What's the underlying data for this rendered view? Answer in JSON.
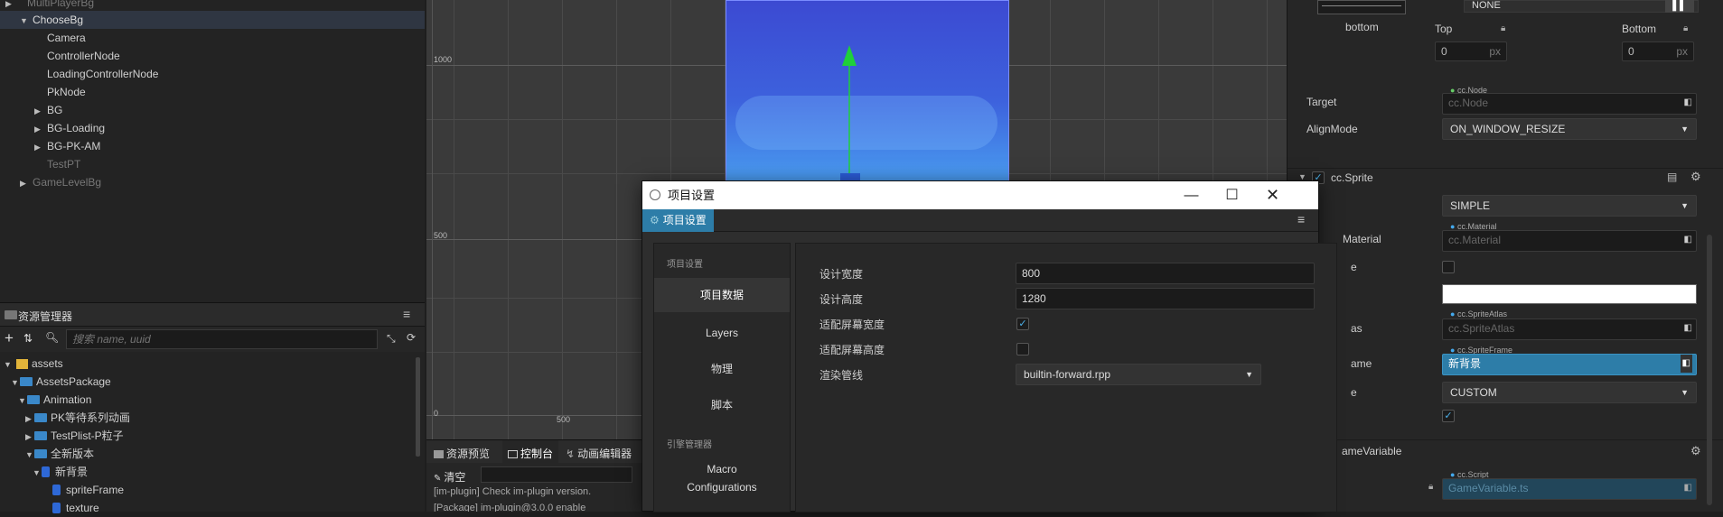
{
  "hierarchy": {
    "items": [
      {
        "label": "MultiPlayerBg",
        "dim": true
      },
      {
        "label": "ChooseBg"
      },
      {
        "label": "Camera"
      },
      {
        "label": "ControllerNode"
      },
      {
        "label": "LoadingControllerNode"
      },
      {
        "label": "PkNode"
      },
      {
        "label": "BG"
      },
      {
        "label": "BG-Loading"
      },
      {
        "label": "BG-PK-AM"
      },
      {
        "label": "TestPT",
        "dim": true
      },
      {
        "label": "GameLevelBg",
        "dim": true
      }
    ]
  },
  "assets": {
    "title": "资源管理器",
    "search_placeholder": "搜索 name, uuid",
    "items": [
      {
        "label": "assets"
      },
      {
        "label": "AssetsPackage"
      },
      {
        "label": "Animation"
      },
      {
        "label": "PK等待系列动画"
      },
      {
        "label": "TestPlist-P粒子"
      },
      {
        "label": "全新版本"
      },
      {
        "label": "新背景"
      },
      {
        "label": "spriteFrame"
      },
      {
        "label": "texture"
      }
    ]
  },
  "scene": {
    "ruler": [
      "1000",
      "500",
      "0",
      "500"
    ]
  },
  "bottom_panel": {
    "tabs": [
      "资源预览",
      "控制台",
      "动画编辑器"
    ],
    "clear_label": "清空",
    "logs": [
      "[im-plugin] Check im-plugin version.",
      "[Package] im-plugin@3.0.0 enable"
    ]
  },
  "dialog": {
    "window_title": "项目设置",
    "tab_label": "项目设置",
    "nav": {
      "section1": "项目设置",
      "items": [
        "项目数据",
        "Layers",
        "物理",
        "脚本"
      ],
      "section2": "引擎管理器",
      "macro": "Macro",
      "configurations": "Configurations"
    },
    "fields": {
      "width_label": "设计宽度",
      "width_value": "800",
      "height_label": "设计高度",
      "height_value": "1280",
      "fit_width_label": "适配屏幕宽度",
      "fit_width_checked": true,
      "fit_height_label": "适配屏幕高度",
      "fit_height_checked": false,
      "pipeline_label": "渲染管线",
      "pipeline_value": "builtin-forward.rpp"
    }
  },
  "inspector": {
    "align_none": "NONE",
    "bottom_caption": "bottom",
    "top_label": "Top",
    "top_value": "0",
    "bottom_label": "Bottom",
    "bottom_value": "0",
    "px": "px",
    "node_tag": "cc.Node",
    "target_label": "Target",
    "target_value": "cc.Node",
    "alignmode_label": "AlignMode",
    "alignmode_value": "ON_WINDOW_RESIZE",
    "sprite_header": "cc.Sprite",
    "sizemode_value": "SIMPLE",
    "material_tag": "cc.Material",
    "material_label": "Material",
    "material_value": "cc.Material",
    "grayscale_label": "e",
    "atlas_tag": "cc.SpriteAtlas",
    "atlas_label": "as",
    "atlas_value": "cc.SpriteAtlas",
    "frame_tag": "cc.SpriteFrame",
    "frame_label": "ame",
    "frame_value": "新背景",
    "type_label": "e",
    "type_value": "CUSTOM",
    "script_header": "ameVariable",
    "script_tag": "cc.Script",
    "script_value": "GameVariable.ts"
  },
  "colors": {
    "accent": "#2d7da8",
    "green_arrow": "#1fcf3a",
    "canvas_top": "#3f4fd6",
    "canvas_bottom": "#4aa6f0"
  }
}
